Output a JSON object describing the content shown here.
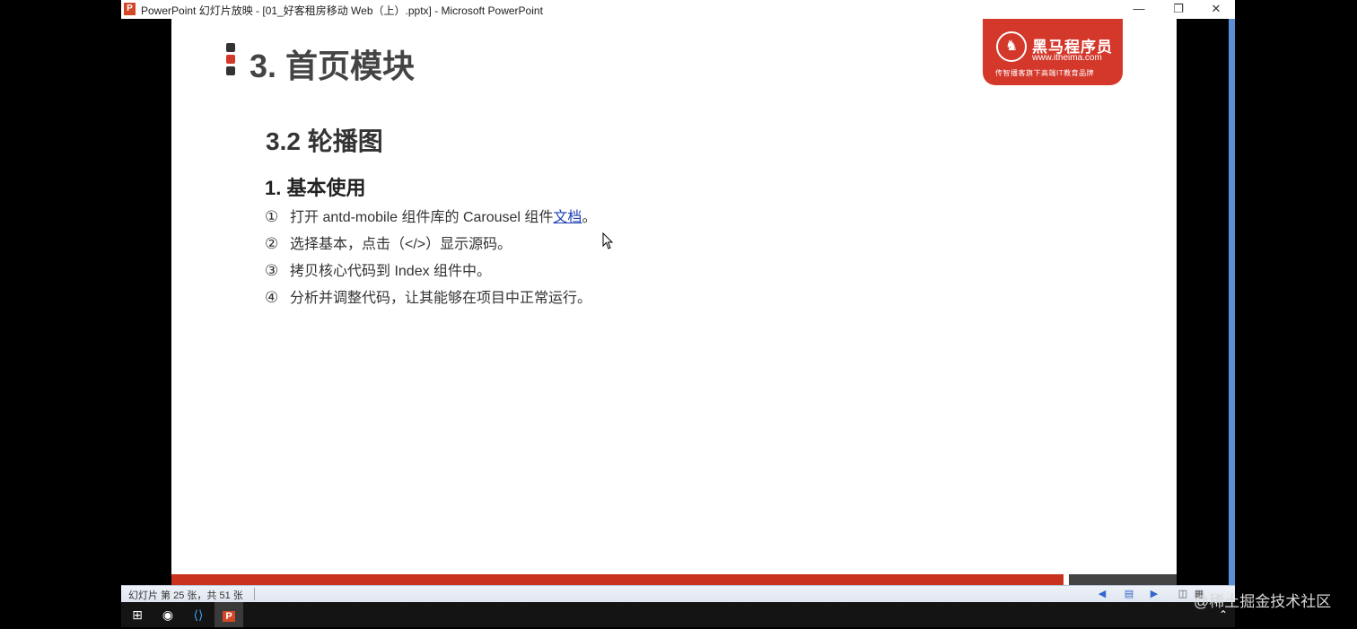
{
  "window": {
    "title": "PowerPoint 幻灯片放映 - [01_好客租房移动 Web（上）.pptx] - Microsoft PowerPoint",
    "app_icon": "P",
    "minimize": "—",
    "restore": "❐",
    "close": "✕"
  },
  "slide": {
    "heading": "3. 首页模块",
    "section": "3.2 轮播图",
    "subsection": "1. 基本使用",
    "items": [
      {
        "num": "①",
        "text": "打开 antd-mobile 组件库的 Carousel 组件",
        "link": "文档",
        "tail": "。"
      },
      {
        "num": "②",
        "text": "选择基本，点击（</>）显示源码。"
      },
      {
        "num": "③",
        "text": "拷贝核心代码到 Index 组件中。"
      },
      {
        "num": "④",
        "text": "分析并调整代码，让其能够在项目中正常运行。"
      }
    ],
    "logo": {
      "name": "黑马程序员",
      "url": "www.itheima.com",
      "slogan": "传智播客旗下高端IT教育品牌"
    }
  },
  "status": {
    "slide_info": "幻灯片 第 25 张，共 51 张"
  },
  "watermark": "@稀土掘金技术社区",
  "colors": {
    "accent_red": "#d4382b",
    "link_blue": "#1f3fb5"
  }
}
